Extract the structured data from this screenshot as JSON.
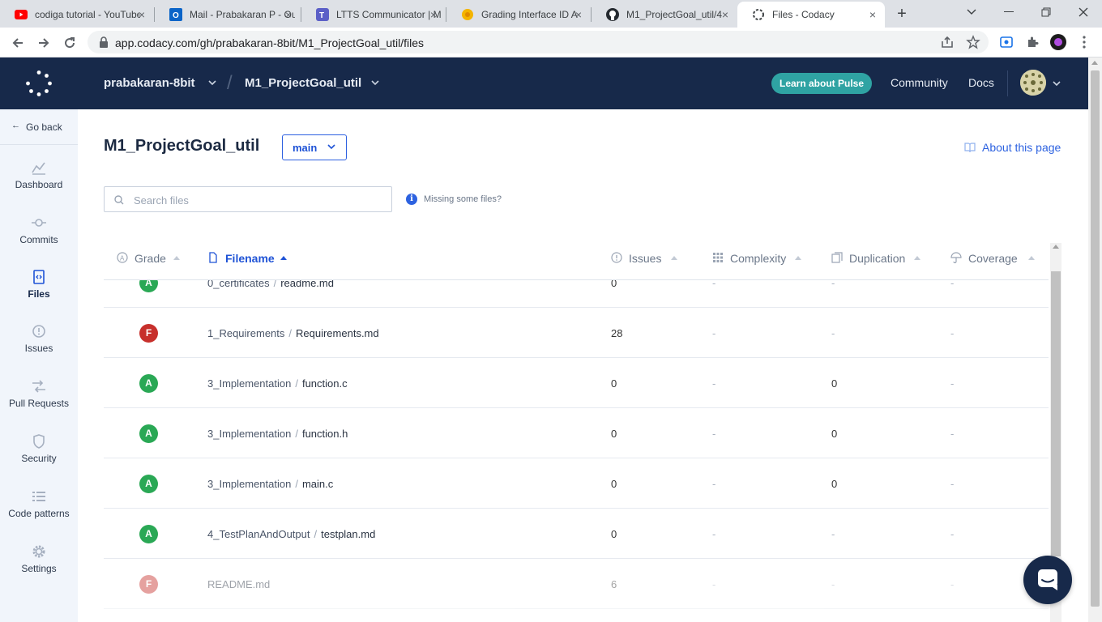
{
  "browser": {
    "tabs": [
      {
        "title": "codiga tutorial - YouTube",
        "icon": "youtube-icon"
      },
      {
        "title": "Mail - Prabakaran P - Outlook",
        "icon": "outlook-icon"
      },
      {
        "title": "LTTS Communicator | Microsoft Teams",
        "icon": "teams-icon"
      },
      {
        "title": "Grading Interface ID A",
        "icon": "grading-icon"
      },
      {
        "title": "M1_ProjectGoal_util/4",
        "icon": "github-icon"
      },
      {
        "title": "Files - Codacy",
        "icon": "codacy-icon"
      }
    ],
    "url": "app.codacy.com/gh/prabakaran-8bit/M1_ProjectGoal_util/files"
  },
  "header": {
    "org": "prabakaran-8bit",
    "separator": "/",
    "repo": "M1_ProjectGoal_util",
    "pulse_button": "Learn about Pulse",
    "community": "Community",
    "docs": "Docs"
  },
  "sidebar": {
    "go_back": "Go back",
    "items": [
      {
        "label": "Dashboard",
        "icon": "dashboard-icon"
      },
      {
        "label": "Commits",
        "icon": "commits-icon"
      },
      {
        "label": "Files",
        "icon": "files-icon",
        "active": true
      },
      {
        "label": "Issues",
        "icon": "issues-icon"
      },
      {
        "label": "Pull Requests",
        "icon": "pull-requests-icon"
      },
      {
        "label": "Security",
        "icon": "security-icon"
      },
      {
        "label": "Code patterns",
        "icon": "code-patterns-icon"
      },
      {
        "label": "Settings",
        "icon": "settings-icon"
      }
    ]
  },
  "main": {
    "title": "M1_ProjectGoal_util",
    "branch": "main",
    "about": "About this page",
    "search_placeholder": "Search files",
    "missing": "Missing some files?",
    "columns": {
      "grade": "Grade",
      "filename": "Filename",
      "issues": "Issues",
      "complexity": "Complexity",
      "duplication": "Duplication",
      "coverage": "Coverage"
    },
    "rows": [
      {
        "grade": "A",
        "dir": "0_certificates",
        "file": "readme.md",
        "issues": "0",
        "complexity": "-",
        "duplication": "-",
        "coverage": "-"
      },
      {
        "grade": "F",
        "dir": "1_Requirements",
        "file": "Requirements.md",
        "issues": "28",
        "complexity": "-",
        "duplication": "-",
        "coverage": "-"
      },
      {
        "grade": "A",
        "dir": "3_Implementation",
        "file": "function.c",
        "issues": "0",
        "complexity": "-",
        "duplication": "0",
        "coverage": "-"
      },
      {
        "grade": "A",
        "dir": "3_Implementation",
        "file": "function.h",
        "issues": "0",
        "complexity": "-",
        "duplication": "0",
        "coverage": "-"
      },
      {
        "grade": "A",
        "dir": "3_Implementation",
        "file": "main.c",
        "issues": "0",
        "complexity": "-",
        "duplication": "0",
        "coverage": "-"
      },
      {
        "grade": "A",
        "dir": "4_TestPlanAndOutput",
        "file": "testplan.md",
        "issues": "0",
        "complexity": "-",
        "duplication": "-",
        "coverage": "-"
      },
      {
        "grade": "F",
        "dir": "",
        "file": "README.md",
        "issues": "6",
        "complexity": "-",
        "duplication": "-",
        "coverage": "-"
      }
    ]
  },
  "colors": {
    "header_bg": "#17294a",
    "accent": "#1f53d6",
    "pulse": "#2fa3a3",
    "grade_a": "#2aa855",
    "grade_f": "#c7302c"
  }
}
